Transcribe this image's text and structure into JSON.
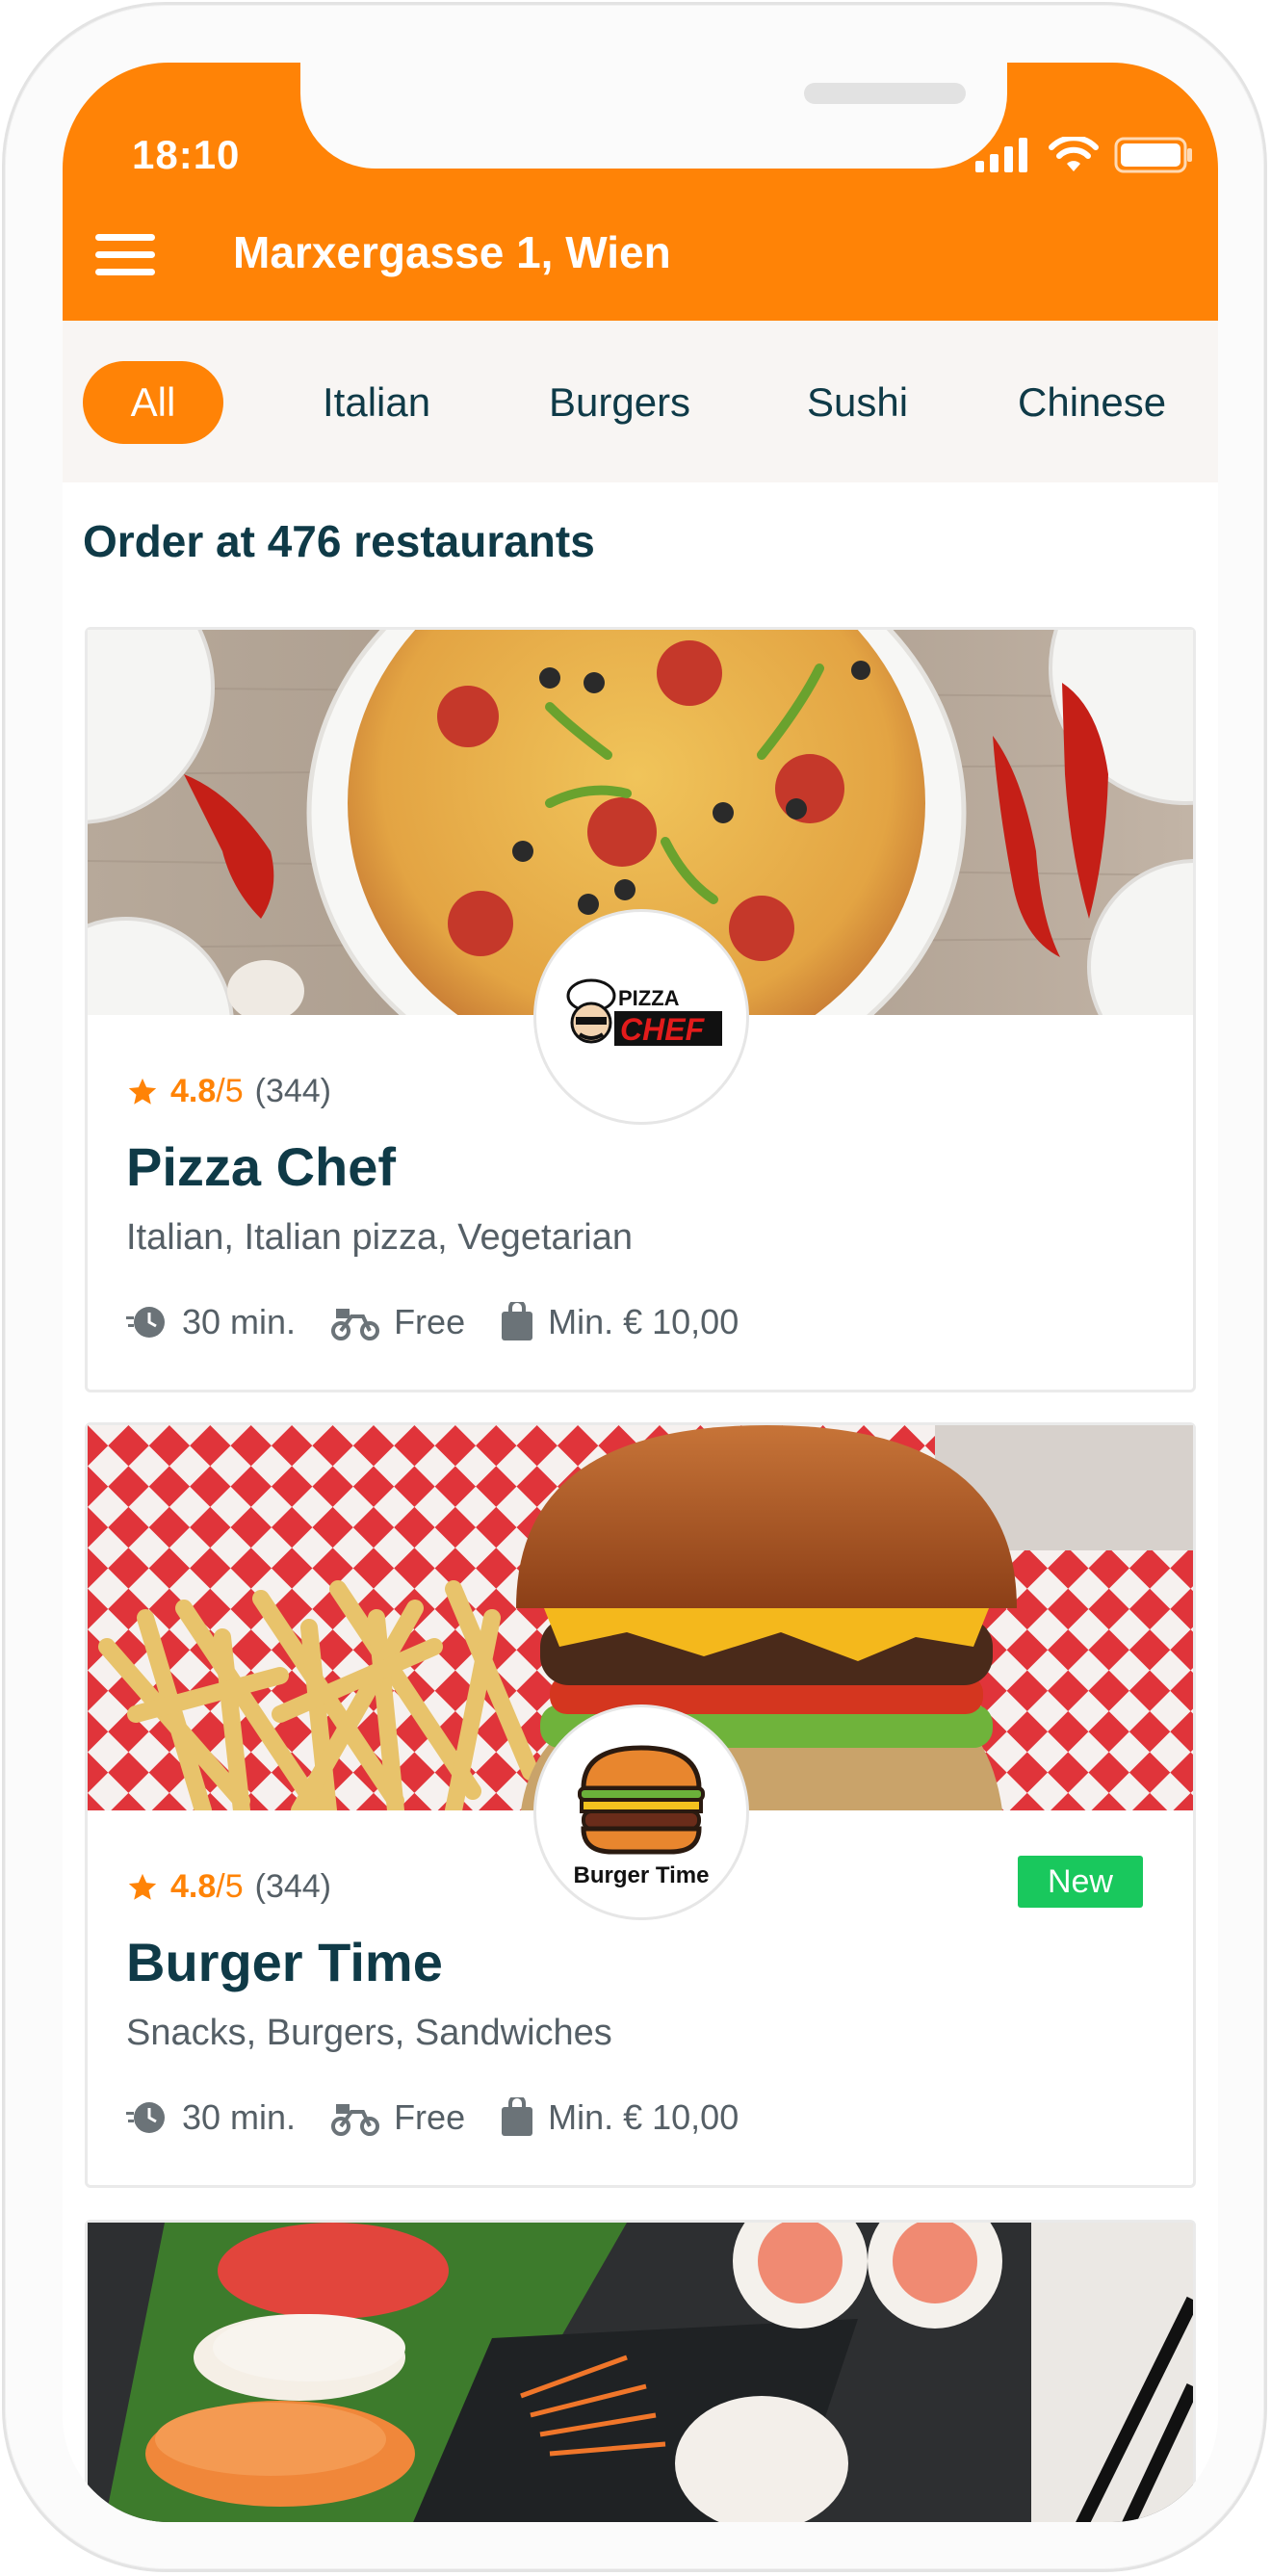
{
  "status": {
    "time": "18:10"
  },
  "header": {
    "address": "Marxergasse 1, Wien"
  },
  "categories": [
    "All",
    "Italian",
    "Burgers",
    "Sushi",
    "Chinese"
  ],
  "order_title": "Order at 476 restaurants",
  "colors": {
    "brand": "#ff8306",
    "text": "#0f3a47",
    "new_badge": "#19c85d",
    "muted": "#555f66"
  },
  "restaurants": [
    {
      "name": "Pizza Chef",
      "rating": "4.8",
      "rating_max": "/5",
      "rating_count": "(344)",
      "tags": "Italian, Italian pizza, Vegetarian",
      "delivery_time": "30 min.",
      "delivery_fee": "Free",
      "min_order": "Min. € 10,00",
      "logo_text_top": "PIZZA",
      "logo_text_bottom": "CHEF"
    },
    {
      "name": "Burger Time",
      "rating": "4.8",
      "rating_max": "/5",
      "rating_count": "(344)",
      "tags": "Snacks, Burgers, Sandwiches",
      "delivery_time": "30 min.",
      "delivery_fee": "Free",
      "min_order": "Min. € 10,00",
      "badge": "New",
      "logo_text": "Burger Time"
    }
  ]
}
